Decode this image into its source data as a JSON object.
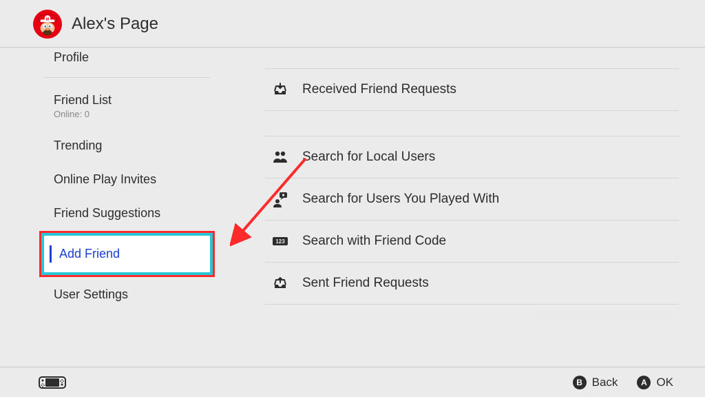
{
  "header": {
    "title": "Alex's Page"
  },
  "sidebar": {
    "items": [
      {
        "label": "Profile",
        "clipped": true
      },
      {
        "label": "Friend List",
        "sub": "Online: 0"
      },
      {
        "label": "Trending"
      },
      {
        "label": "Online Play Invites"
      },
      {
        "label": "Friend Suggestions"
      },
      {
        "label": "Add Friend",
        "selected": true
      },
      {
        "label": "User Settings"
      }
    ]
  },
  "main": {
    "items": [
      {
        "icon": "inbox-down-icon",
        "label": "Received Friend Requests",
        "groupStart": true
      },
      {
        "icon": "people-icon",
        "label": "Search for Local Users",
        "groupStart": true,
        "gapBefore": true
      },
      {
        "icon": "speech-user-icon",
        "label": "Search for Users You Played With"
      },
      {
        "icon": "numbers-icon",
        "label": "Search with Friend Code"
      },
      {
        "icon": "outbox-up-icon",
        "label": "Sent Friend Requests"
      }
    ],
    "hint": "You have no new friend requests."
  },
  "footer": {
    "back": {
      "glyph": "B",
      "label": "Back"
    },
    "ok": {
      "glyph": "A",
      "label": "OK"
    }
  },
  "icons": {
    "inbox-down-icon": "inbox-down",
    "people-icon": "people",
    "speech-user-icon": "speech-user",
    "numbers-icon": "123",
    "outbox-up-icon": "outbox-up"
  }
}
